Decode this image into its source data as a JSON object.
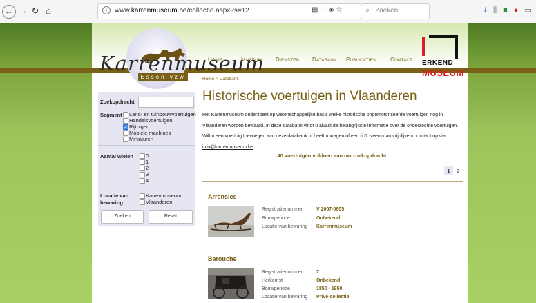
{
  "browser": {
    "url_prefix": "www.",
    "url_domain": "karrenmuseum.be",
    "url_path": "/collectie.aspx?s=12",
    "url_tools": "▤  ···  ◈  ☆",
    "search_placeholder": "Zoeken"
  },
  "header": {
    "logo_text": "Karrenmuseum",
    "logo_sub": "Essen vzw",
    "nav": [
      "Home",
      "Museum",
      "Diensten",
      "Databank",
      "Publicaties",
      "Contact"
    ],
    "badge_line1": "ERKEND",
    "badge_line2": "MUSEUM"
  },
  "sidebar": {
    "search_label": "Zoekopdracht",
    "search_value": "",
    "segment_label": "Segment",
    "segments": [
      {
        "label": "Land- en tuinbouwvoertuigen",
        "checked": false
      },
      {
        "label": "Handelsvoertuigen",
        "checked": false
      },
      {
        "label": "Rijtuigen",
        "checked": true
      },
      {
        "label": "Mobiele machines",
        "checked": false
      },
      {
        "label": "Miniaturen",
        "checked": false
      }
    ],
    "wheels_label": "Aantal wielen",
    "wheels": [
      "0",
      "1",
      "2",
      "3",
      "4"
    ],
    "location_label_1": "Locatie van",
    "location_label_2": "bewaring",
    "locations": [
      "Karrenmuseum",
      "Vlaanderen"
    ],
    "search_button": "Zoeken",
    "reset_button": "Reset"
  },
  "main": {
    "breadcrumb_home": "Home",
    "breadcrumb_sep": " > ",
    "breadcrumb_current": "Databank",
    "title": "Historische voertuigen in Vlaanderen",
    "intro": "Het Karrenmuseum onderzoekt op wetenschappelijke basis welke historische ongemotoriseerde voertuigen nog in Vlaanderen worden bewaard. In deze databank vindt u alvast de belangrijkste informatie over de onderzochte voertuigen. Wilt u een voertuig toevoegen aan deze databank of heeft u vragen of een tip? Neem dan vrijblijvend contact op via ",
    "intro_email": "info@karrenmuseum.be",
    "intro_end": ".",
    "result_count": "40 voertuigen voldoen aan uw zoekopdracht.",
    "pages": [
      "1",
      "2"
    ],
    "items": [
      {
        "title": "Arrenslee",
        "fields": [
          {
            "k": "Registratienummer",
            "v": "V 2007-0605"
          },
          {
            "k": "Bouwperiode",
            "v": "Onbekend"
          },
          {
            "k": "Locatie van bewaring",
            "v": "Karrenmuseum"
          }
        ]
      },
      {
        "title": "Barouche",
        "fields": [
          {
            "k": "Registratienummer",
            "v": "7"
          },
          {
            "k": "Herkomst",
            "v": "Onbekend"
          },
          {
            "k": "Bouwperiode",
            "v": "1850 - 1950"
          },
          {
            "k": "Locatie van bewaring",
            "v": "Privé-collectie"
          }
        ]
      }
    ]
  }
}
